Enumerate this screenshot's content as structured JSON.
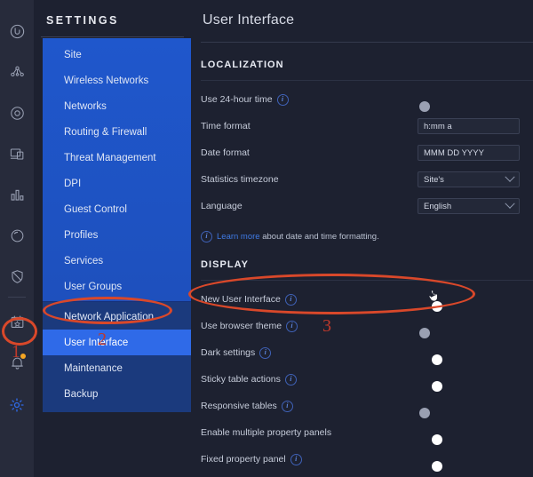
{
  "rail": {
    "icons": [
      {
        "name": "unifi-logo-icon",
        "label": "UniFi"
      },
      {
        "name": "topology-icon",
        "label": "Topology"
      },
      {
        "name": "wifi-circle-icon",
        "label": "WiFi"
      },
      {
        "name": "devices-icon",
        "label": "Devices"
      },
      {
        "name": "statistics-icon",
        "label": "Statistics"
      },
      {
        "name": "clients-icon",
        "label": "Clients"
      },
      {
        "name": "shield-icon",
        "label": "Threat Management"
      },
      {
        "name": "insights-calendar-icon",
        "label": "Insights"
      },
      {
        "name": "alerts-bell-icon",
        "label": "Alerts"
      },
      {
        "name": "settings-gear-icon",
        "label": "Settings"
      }
    ]
  },
  "sidebar": {
    "title": "SETTINGS",
    "top_items": [
      {
        "label": "Site"
      },
      {
        "label": "Wireless Networks"
      },
      {
        "label": "Networks"
      },
      {
        "label": "Routing & Firewall"
      },
      {
        "label": "Threat Management"
      },
      {
        "label": "DPI"
      },
      {
        "label": "Guest Control"
      },
      {
        "label": "Profiles"
      },
      {
        "label": "Services"
      },
      {
        "label": "User Groups"
      }
    ],
    "bottom_items": [
      {
        "label": "Network Application",
        "active": false
      },
      {
        "label": "User Interface",
        "active": true
      },
      {
        "label": "Maintenance",
        "active": false
      },
      {
        "label": "Backup",
        "active": false
      }
    ]
  },
  "main": {
    "page_title": "User Interface",
    "localization": {
      "heading": "LOCALIZATION",
      "rows": [
        {
          "label": "Use 24-hour time",
          "info": true,
          "control": "toggle",
          "value": "off"
        },
        {
          "label": "Time format",
          "info": false,
          "control": "text",
          "value": "h:mm a"
        },
        {
          "label": "Date format",
          "info": false,
          "control": "text",
          "value": "MMM DD YYYY"
        },
        {
          "label": "Statistics timezone",
          "info": false,
          "control": "select",
          "value": "Site's"
        },
        {
          "label": "Language",
          "info": false,
          "control": "select",
          "value": "English"
        }
      ],
      "learn_more_link": "Learn more",
      "learn_more_rest": "about date and time formatting."
    },
    "display": {
      "heading": "DISPLAY",
      "rows": [
        {
          "label": "New User Interface",
          "info": true,
          "control": "toggle",
          "value": "on"
        },
        {
          "label": "Use browser theme",
          "info": true,
          "control": "toggle",
          "value": "off"
        },
        {
          "label": "Dark settings",
          "info": true,
          "control": "toggle",
          "value": "on"
        },
        {
          "label": "Sticky table actions",
          "info": true,
          "control": "toggle",
          "value": "on"
        },
        {
          "label": "Responsive tables",
          "info": true,
          "control": "toggle",
          "value": "off"
        },
        {
          "label": "Enable multiple property panels",
          "info": false,
          "control": "toggle",
          "value": "on"
        },
        {
          "label": "Fixed property panel",
          "info": true,
          "control": "toggle",
          "value": "on"
        }
      ]
    }
  },
  "annotations": {
    "color": "#d9482a",
    "markers": [
      {
        "name": "annotation-1",
        "text": "1",
        "target": "settings-gear-icon"
      },
      {
        "name": "annotation-2",
        "text": "2",
        "target": "sidebar-item-user-interface"
      },
      {
        "name": "annotation-3",
        "text": "3",
        "target": "new-user-interface-toggle"
      }
    ]
  },
  "colors": {
    "accent_blue": "#2e6ce6",
    "menu_blue": "#1f57cc",
    "menu_dark_blue": "#1b3a7d",
    "background": "#1d2130",
    "rail": "#272b3b",
    "annotation_red": "#d9482a"
  }
}
